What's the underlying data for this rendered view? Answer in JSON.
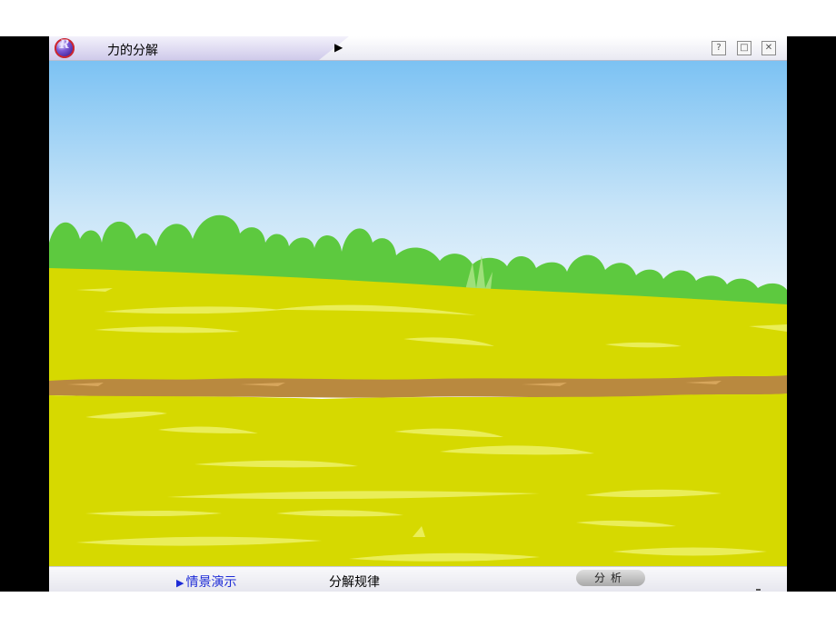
{
  "window": {
    "title": "力的分解",
    "logo_letter": "R",
    "play_glyph": "▶",
    "help_glyph": "?",
    "restore_glyph": "□",
    "close_glyph": "✕"
  },
  "colors": {
    "sky_top": "#7cc2f3",
    "sky_bottom": "#f4f9fd",
    "bushes": "#5dc93f",
    "field": "#d6d900",
    "field_highlight": "#eef06a",
    "path": "#b9893f",
    "nav_active": "#1d2bd6"
  },
  "bottom_bar": {
    "active_marker": "▶",
    "scene_demo_label": "情景演示",
    "decomposition_rule_label": "分解规律",
    "analyze_button_label": "分析"
  }
}
